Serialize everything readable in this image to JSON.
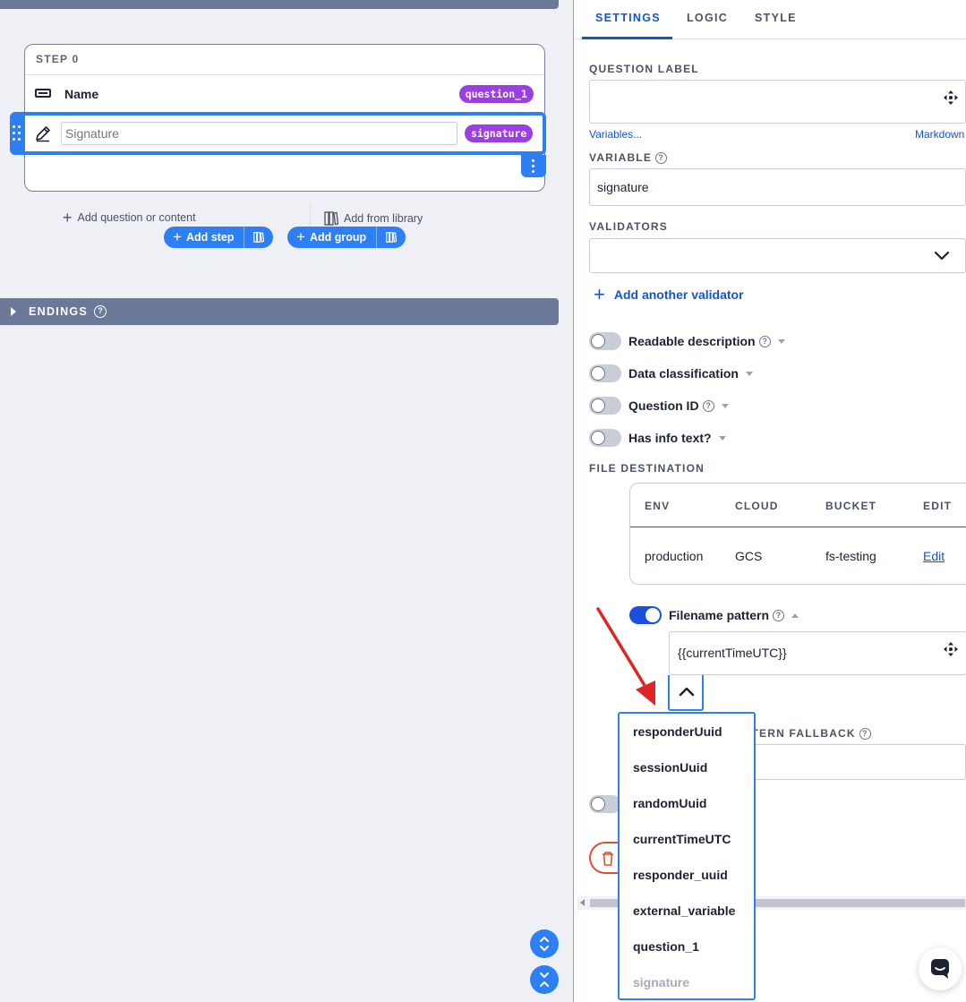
{
  "canvas": {
    "step": {
      "title": "STEP 0",
      "questions": [
        {
          "label": "Name",
          "variable": "question_1"
        },
        {
          "placeholder": "Signature",
          "variable": "signature"
        }
      ],
      "add_question_label": "Add question or content",
      "add_library_label": "Add from library"
    },
    "add_step_label": "Add step",
    "add_group_label": "Add group",
    "endings_label": "ENDINGS"
  },
  "panel": {
    "tabs": [
      {
        "label": "SETTINGS",
        "active": true
      },
      {
        "label": "LOGIC",
        "active": false
      },
      {
        "label": "STYLE",
        "active": false
      }
    ],
    "question_label": {
      "title": "QUESTION LABEL",
      "value": "",
      "variables_link": "Variables...",
      "markdown_link": "Markdown"
    },
    "variable": {
      "title": "VARIABLE",
      "value": "signature"
    },
    "validators": {
      "title": "VALIDATORS",
      "value": "",
      "add_label": "Add another validator"
    },
    "toggles": [
      {
        "label": "Readable description",
        "on": false,
        "help": true
      },
      {
        "label": "Data classification",
        "on": false,
        "help": false
      },
      {
        "label": "Question ID",
        "on": false,
        "help": true
      },
      {
        "label": "Has info text?",
        "on": false,
        "help": false
      }
    ],
    "file_destination": {
      "title": "FILE DESTINATION",
      "columns": [
        "ENV",
        "CLOUD",
        "BUCKET",
        "EDIT"
      ],
      "rows": [
        {
          "env": "production",
          "cloud": "GCS",
          "bucket": "fs-testing",
          "edit": "Edit"
        }
      ]
    },
    "filename_pattern": {
      "label": "Filename pattern",
      "on": true,
      "value": "{{currentTimeUTC}}"
    },
    "fallback_title_visible": "TTERN FALLBACK"
  },
  "dropdown": {
    "options": [
      "responderUuid",
      "sessionUuid",
      "randomUuid",
      "currentTimeUTC",
      "responder_uuid",
      "external_variable",
      "question_1",
      "signature"
    ],
    "disabled_option": "signature"
  },
  "colors": {
    "accent": "#2d7ff5",
    "link": "#1254d6",
    "pill": "#9a3fe0",
    "bar": "#6b7897",
    "annotation_arrow": "#e02424"
  }
}
